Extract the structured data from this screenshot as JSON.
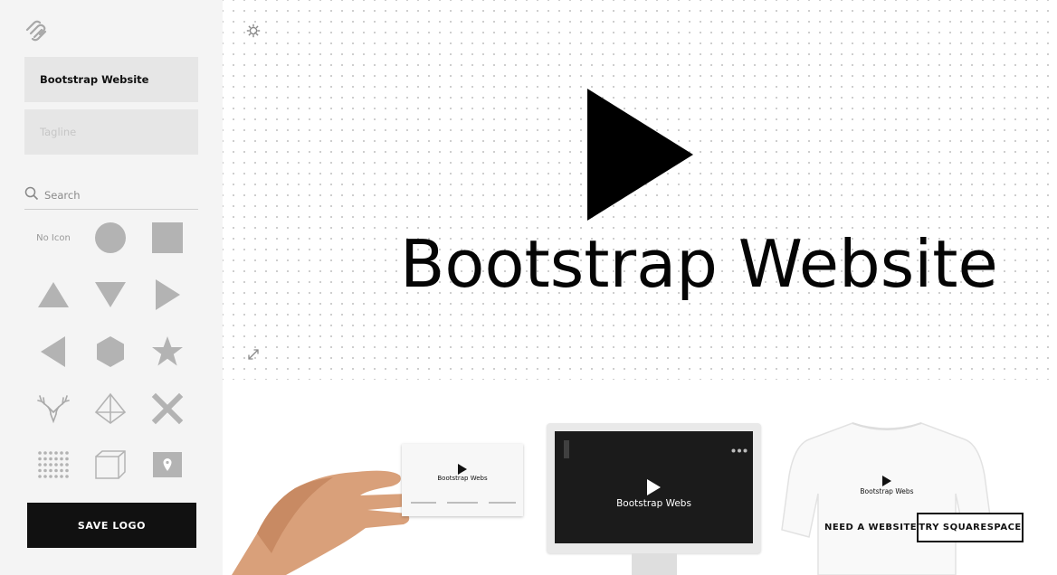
{
  "sidebar": {
    "logo_icon": "squarespace-logo-icon",
    "business_name": "Bootstrap Website",
    "tagline_placeholder": "Tagline",
    "search_placeholder": "Search",
    "no_icon_label": "No Icon",
    "icons": [
      "no-icon",
      "circle-icon",
      "square-icon",
      "triangle-up-icon",
      "triangle-down-icon",
      "triangle-right-icon",
      "triangle-left-icon",
      "hexagon-icon",
      "star-icon",
      "deer-icon",
      "diamond-icon",
      "x-icon",
      "dot-grid-icon",
      "cube-icon",
      "map-pin-icon"
    ],
    "save_label": "SAVE LOGO"
  },
  "canvas": {
    "settings_icon": "gear-icon",
    "expand_icon": "expand-icon",
    "logo_icon": "play-icon",
    "logo_text": "Bootstrap Website"
  },
  "mockups": {
    "card_text": "Bootstrap Webs",
    "monitor_text": "Bootstrap Webs",
    "shirt_text": "Bootstrap Webs"
  },
  "cta": {
    "need_label": "NEED A WEBSITE?",
    "try_label": "TRY SQUARESPACE"
  },
  "colors": {
    "sidebar_bg": "#f4f4f4",
    "field_bg": "#e6e6e6",
    "icon_gray": "#b3b3b3",
    "button_bg": "#111111",
    "text_dark": "#050505"
  }
}
